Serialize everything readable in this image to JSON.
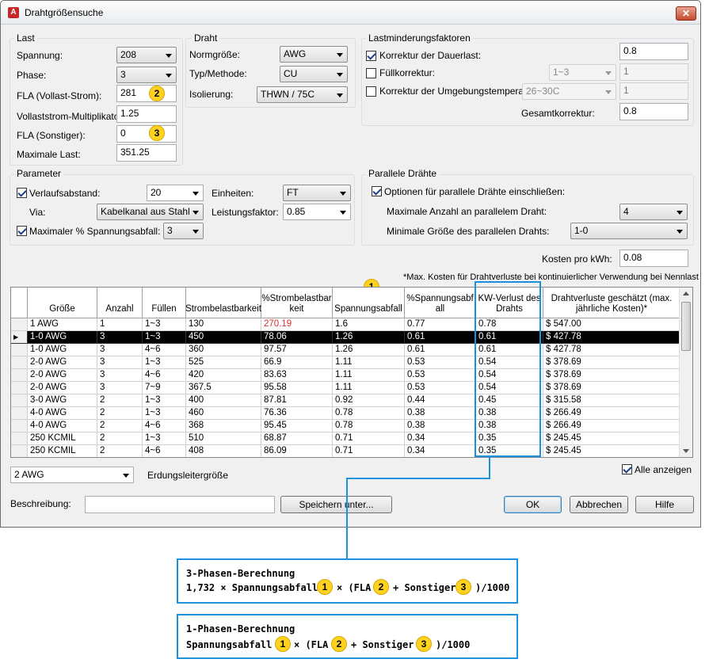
{
  "window": {
    "title": "Drahtgrößensuche",
    "close": "✕"
  },
  "last": {
    "title": "Last",
    "spannung_label": "Spannung:",
    "spannung_value": "208",
    "phase_label": "Phase:",
    "phase_value": "3",
    "fla_label": "FLA (Vollast-Strom):",
    "fla_value": "281",
    "mult_label": "Vollaststrom-Multiplikator:",
    "mult_value": "1.25",
    "fla_other_label": "FLA (Sonstiger):",
    "fla_other_value": "0",
    "max_label": "Maximale Last:",
    "max_value": "351.25"
  },
  "draht": {
    "title": "Draht",
    "norm_label": "Normgröße:",
    "norm_value": "AWG",
    "typ_label": "Typ/Methode:",
    "typ_value": "CU",
    "iso_label": "Isolierung:",
    "iso_value": "THWN / 75C"
  },
  "factors": {
    "title": "Lastminderungsfaktoren",
    "dauer_label": "Korrektur der Dauerlast:",
    "dauer_value": "0.8",
    "fuell_label": "Füllkorrektur:",
    "fuell_combo": "1~3",
    "fuell_value": "1",
    "temp_label": "Korrektur der Umgebungstemperatur:",
    "temp_combo": "26~30C",
    "temp_value": "1",
    "gesamt_label": "Gesamtkorrektur:",
    "gesamt_value": "0.8"
  },
  "params": {
    "title": "Parameter",
    "verlauf_label": "Verlaufsabstand:",
    "verlauf_value": "20",
    "einheiten_label": "Einheiten:",
    "einheiten_value": "FT",
    "via_label": "Via:",
    "via_value": "Kabelkanal aus Stahl",
    "pf_label": "Leistungsfaktor:",
    "pf_value": "0.85",
    "maxspan_label": "Maximaler % Spannungsabfall:",
    "maxspan_value": "3"
  },
  "parallel": {
    "title": "Parallele Drähte",
    "opt_label": "Optionen für parallele Drähte einschließen:",
    "max_label": "Maximale Anzahl an parallelem Draht:",
    "max_value": "4",
    "min_label": "Minimale Größe des parallelen Drahts:",
    "min_value": "1-0"
  },
  "kosten": {
    "label": "Kosten pro kWh:",
    "value": "0.08",
    "note": "*Max. Kosten für Drahtverluste bei kontinuierlicher Verwendung bei Nennlast"
  },
  "badges": {
    "one": "1",
    "two": "2",
    "three": "3"
  },
  "table": {
    "headers": {
      "groesse": "Größe",
      "anzahl": "Anzahl",
      "fuellen": "Füllen",
      "strom": "Strombelastbarkeit",
      "pct_strom": "%Strombelastbarkeit",
      "abfall": "Spannungsabfall",
      "pct_abfall": "%Spannungsabfall",
      "kw": "KW-Verlust des Drahts",
      "kosten": "Drahtverluste geschätzt (max. jährliche Kosten)*"
    },
    "rows": [
      {
        "groesse": "1 AWG",
        "anzahl": "1",
        "fuellen": "1~3",
        "strom": "130",
        "pct_strom": "270.19",
        "abfall": "1.6",
        "pct_abfall": "0.77",
        "kw": "0.78",
        "kosten": "$ 547.00"
      },
      {
        "groesse": "1-0 AWG",
        "anzahl": "3",
        "fuellen": "1~3",
        "strom": "450",
        "pct_strom": "78.06",
        "abfall": "1.26",
        "pct_abfall": "0.61",
        "kw": "0.61",
        "kosten": "$ 427.78"
      },
      {
        "groesse": "1-0 AWG",
        "anzahl": "3",
        "fuellen": "4~6",
        "strom": "360",
        "pct_strom": "97.57",
        "abfall": "1.26",
        "pct_abfall": "0.61",
        "kw": "0.61",
        "kosten": "$ 427.78"
      },
      {
        "groesse": "2-0 AWG",
        "anzahl": "3",
        "fuellen": "1~3",
        "strom": "525",
        "pct_strom": "66.9",
        "abfall": "1.11",
        "pct_abfall": "0.53",
        "kw": "0.54",
        "kosten": "$ 378.69"
      },
      {
        "groesse": "2-0 AWG",
        "anzahl": "3",
        "fuellen": "4~6",
        "strom": "420",
        "pct_strom": "83.63",
        "abfall": "1.11",
        "pct_abfall": "0.53",
        "kw": "0.54",
        "kosten": "$ 378.69"
      },
      {
        "groesse": "2-0 AWG",
        "anzahl": "3",
        "fuellen": "7~9",
        "strom": "367.5",
        "pct_strom": "95.58",
        "abfall": "1.11",
        "pct_abfall": "0.53",
        "kw": "0.54",
        "kosten": "$ 378.69"
      },
      {
        "groesse": "3-0 AWG",
        "anzahl": "2",
        "fuellen": "1~3",
        "strom": "400",
        "pct_strom": "87.81",
        "abfall": "0.92",
        "pct_abfall": "0.44",
        "kw": "0.45",
        "kosten": "$ 315.58"
      },
      {
        "groesse": "4-0 AWG",
        "anzahl": "2",
        "fuellen": "1~3",
        "strom": "460",
        "pct_strom": "76.36",
        "abfall": "0.78",
        "pct_abfall": "0.38",
        "kw": "0.38",
        "kosten": "$ 266.49"
      },
      {
        "groesse": "4-0 AWG",
        "anzahl": "2",
        "fuellen": "4~6",
        "strom": "368",
        "pct_strom": "95.45",
        "abfall": "0.78",
        "pct_abfall": "0.38",
        "kw": "0.38",
        "kosten": "$ 266.49"
      },
      {
        "groesse": "250 KCMIL",
        "anzahl": "2",
        "fuellen": "1~3",
        "strom": "510",
        "pct_strom": "68.87",
        "abfall": "0.71",
        "pct_abfall": "0.34",
        "kw": "0.35",
        "kosten": "$ 245.45"
      },
      {
        "groesse": "250 KCMIL",
        "anzahl": "2",
        "fuellen": "4~6",
        "strom": "408",
        "pct_strom": "86.09",
        "abfall": "0.71",
        "pct_abfall": "0.34",
        "kw": "0.35",
        "kosten": "$ 245.45"
      }
    ],
    "selected_row": 1
  },
  "bottom": {
    "erdung_value": "2 AWG",
    "erdung_label": "Erdungsleitergröße",
    "alle_label": "Alle anzeigen",
    "beschreibung_label": "Beschreibung:",
    "beschreibung_value": "",
    "save_label": "Speichern unter...",
    "ok_label": "OK",
    "cancel_label": "Abbrechen",
    "help_label": "Hilfe"
  },
  "callouts": {
    "three_phase_title": "3-Phasen-Berechnung",
    "three_a": "1,732 × Spannungsabfall",
    "three_b": "× (FLA",
    "three_c": "+ Sonstiger",
    "three_d": ")/1000",
    "one_phase_title": "1-Phasen-Berechnung",
    "one_a": "Spannungsabfall",
    "one_b": "× (FLA",
    "one_c": "+ Sonstiger",
    "one_d": ")/1000"
  },
  "colors": {
    "callout_blue": "#1e90e0",
    "badge_yellow": "#ffd21f",
    "warn_red": "#d32f2f"
  }
}
